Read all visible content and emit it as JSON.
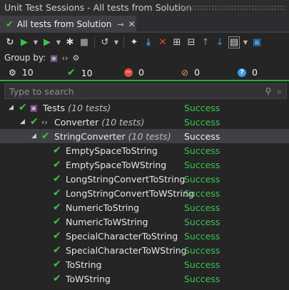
{
  "window": {
    "title": "Unit Test Sessions - All tests from Solution"
  },
  "tab": {
    "label": "All tests from Solution",
    "pin": "⊸",
    "close": "✕"
  },
  "toolbar": {
    "icons": [
      "refresh-icon",
      "run-all-icon",
      "run-icon",
      "debug-icon",
      "stop-icon",
      "build-icon",
      "dotcover-icon",
      "import-icon",
      "remove-icon",
      "expand-all-icon",
      "collapse-all-icon",
      "previous-failed-icon",
      "next-failed-icon",
      "layout-icon",
      "track-icon"
    ]
  },
  "groupby": {
    "label": "Group by:"
  },
  "counts": {
    "total": "10",
    "passed": "10",
    "failed": "0",
    "ignored": "0",
    "unknown": "0"
  },
  "search": {
    "placeholder": "Type to search"
  },
  "tree": {
    "root": {
      "label": "Tests",
      "count": "(10 tests)",
      "status": "Success"
    },
    "namespace": {
      "label": "Converter",
      "count": "(10 tests)",
      "status": "Success"
    },
    "class": {
      "label": "StringConverter",
      "count": "(10 tests)",
      "status": "Success"
    },
    "tests": [
      {
        "label": "EmptySpaceToString",
        "status": "Success"
      },
      {
        "label": "EmptySpaceToWString",
        "status": "Success"
      },
      {
        "label": "LongStringConvertToString",
        "status": "Success"
      },
      {
        "label": "LongStringConvertToWString",
        "status": "Success"
      },
      {
        "label": "NumericToString",
        "status": "Success"
      },
      {
        "label": "NumericToWString",
        "status": "Success"
      },
      {
        "label": "SpecialCharacterToString",
        "status": "Success"
      },
      {
        "label": "SpecialCharacterToWString",
        "status": "Success"
      },
      {
        "label": "ToString",
        "status": "Success"
      },
      {
        "label": "ToWString",
        "status": "Success"
      }
    ]
  },
  "colors": {
    "success": "#3bc44b",
    "accent": "#2fa83a",
    "background": "#252526"
  }
}
